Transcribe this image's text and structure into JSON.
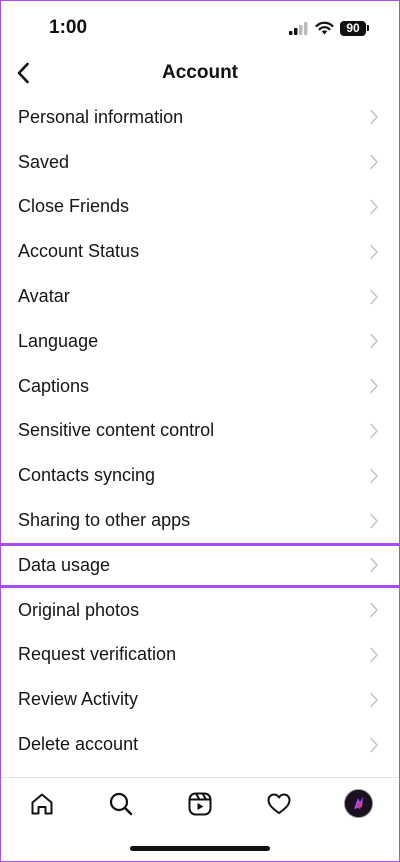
{
  "status_bar": {
    "time": "1:00",
    "battery": "90"
  },
  "header": {
    "title": "Account",
    "back_icon": "chevron-left-icon"
  },
  "menu": {
    "items": [
      {
        "label": "Personal information"
      },
      {
        "label": "Saved"
      },
      {
        "label": "Close Friends"
      },
      {
        "label": "Account Status"
      },
      {
        "label": "Avatar"
      },
      {
        "label": "Language"
      },
      {
        "label": "Captions"
      },
      {
        "label": "Sensitive content control"
      },
      {
        "label": "Contacts syncing"
      },
      {
        "label": "Sharing to other apps"
      },
      {
        "label": "Data usage",
        "highlighted": true
      },
      {
        "label": "Original photos"
      },
      {
        "label": "Request verification"
      },
      {
        "label": "Review Activity"
      },
      {
        "label": "Delete account"
      }
    ]
  },
  "tab_bar": {
    "tabs": [
      "home-icon",
      "search-icon",
      "reels-icon",
      "heart-icon",
      "profile-avatar"
    ]
  },
  "colors": {
    "highlight": "#a64cf0",
    "chevron": "#c4c4c4",
    "text": "#161616"
  }
}
